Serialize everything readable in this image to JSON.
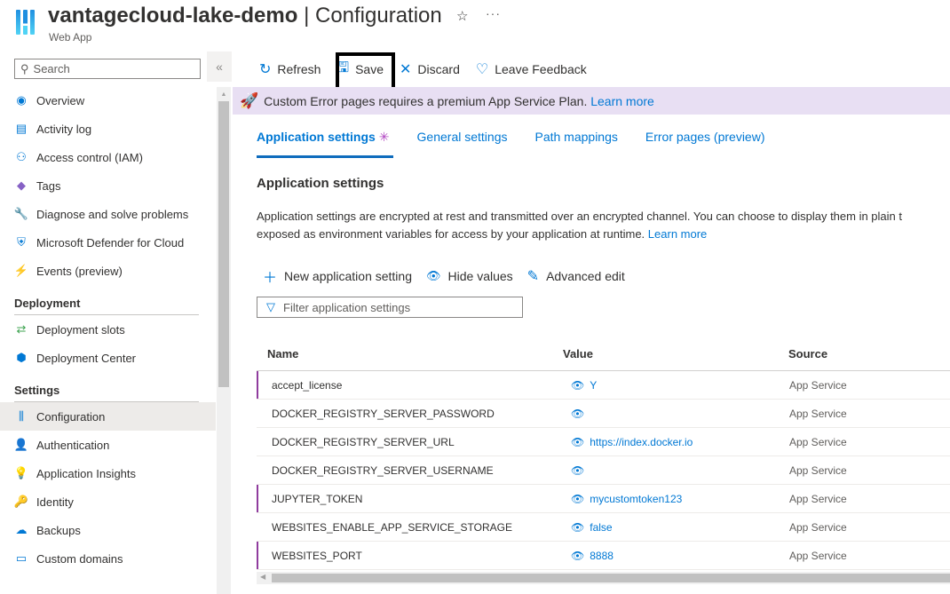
{
  "header": {
    "resource_name": "vantagecloud-lake-demo",
    "separator": " | ",
    "page": "Configuration",
    "subtitle": "Web App",
    "star": "☆",
    "more": "···"
  },
  "sidebar": {
    "search_placeholder": "Search",
    "collapse": "«",
    "items": [
      {
        "label": "Overview",
        "icon": "globe-icon",
        "glyph": "◉",
        "color": "#0078d4"
      },
      {
        "label": "Activity log",
        "icon": "log-icon",
        "glyph": "▤",
        "color": "#0078d4"
      },
      {
        "label": "Access control (IAM)",
        "icon": "people-icon",
        "glyph": "⚇",
        "color": "#0078d4"
      },
      {
        "label": "Tags",
        "icon": "tag-icon",
        "glyph": "◆",
        "color": "#8661c5"
      },
      {
        "label": "Diagnose and solve problems",
        "icon": "wrench-icon",
        "glyph": "🔧",
        "color": "#323130"
      },
      {
        "label": "Microsoft Defender for Cloud",
        "icon": "shield-icon",
        "glyph": "⛨",
        "color": "#0078d4"
      },
      {
        "label": "Events (preview)",
        "icon": "lightning-icon",
        "glyph": "⚡",
        "color": "#ffb900"
      }
    ],
    "sections": [
      {
        "title": "Deployment",
        "items": [
          {
            "label": "Deployment slots",
            "icon": "deployment-slots-icon",
            "glyph": "⇄",
            "color": "#3ca34f"
          },
          {
            "label": "Deployment Center",
            "icon": "cube-icon",
            "glyph": "⬢",
            "color": "#0078d4"
          }
        ]
      },
      {
        "title": "Settings",
        "items": [
          {
            "label": "Configuration",
            "icon": "configuration-icon",
            "glyph": "⫼",
            "color": "#0078d4",
            "active": true
          },
          {
            "label": "Authentication",
            "icon": "user-key-icon",
            "glyph": "👤",
            "color": "#0078d4"
          },
          {
            "label": "Application Insights",
            "icon": "lightbulb-icon",
            "glyph": "💡",
            "color": "#8661c5"
          },
          {
            "label": "Identity",
            "icon": "key-icon",
            "glyph": "🔑",
            "color": "#ffb900"
          },
          {
            "label": "Backups",
            "icon": "cloud-icon",
            "glyph": "☁",
            "color": "#0078d4"
          },
          {
            "label": "Custom domains",
            "icon": "www-icon",
            "glyph": "▭",
            "color": "#0078d4"
          }
        ]
      }
    ]
  },
  "toolbar": {
    "refresh": "Refresh",
    "save": "Save",
    "discard": "Discard",
    "feedback": "Leave Feedback"
  },
  "banner": {
    "text": "Custom Error pages requires a premium App Service Plan.",
    "link": "Learn more"
  },
  "tabs": [
    {
      "label": "Application settings",
      "active": true,
      "modified": "✳"
    },
    {
      "label": "General settings"
    },
    {
      "label": "Path mappings"
    },
    {
      "label": "Error pages (preview)"
    }
  ],
  "content": {
    "title": "Application settings",
    "description_line1": "Application settings are encrypted at rest and transmitted over an encrypted channel. You can choose to display them in plain t",
    "description_line2": "exposed as environment variables for access by your application at runtime.",
    "learn_more": "Learn more",
    "actions": {
      "new": "New application setting",
      "hide": "Hide values",
      "advanced": "Advanced edit"
    },
    "filter_placeholder": "Filter application settings"
  },
  "table": {
    "columns": [
      "Name",
      "Value",
      "Source"
    ],
    "rows": [
      {
        "name": "accept_license",
        "value": "Y",
        "source": "App Service",
        "modified": true
      },
      {
        "name": "DOCKER_REGISTRY_SERVER_PASSWORD",
        "value": "",
        "source": "App Service",
        "modified": false
      },
      {
        "name": "DOCKER_REGISTRY_SERVER_URL",
        "value": "https://index.docker.io",
        "source": "App Service",
        "modified": false
      },
      {
        "name": "DOCKER_REGISTRY_SERVER_USERNAME",
        "value": "",
        "source": "App Service",
        "modified": false
      },
      {
        "name": "JUPYTER_TOKEN",
        "value": "mycustomtoken123",
        "source": "App Service",
        "modified": true
      },
      {
        "name": "WEBSITES_ENABLE_APP_SERVICE_STORAGE",
        "value": "false",
        "source": "App Service",
        "modified": false
      },
      {
        "name": "WEBSITES_PORT",
        "value": "8888",
        "source": "App Service",
        "modified": true
      }
    ]
  }
}
